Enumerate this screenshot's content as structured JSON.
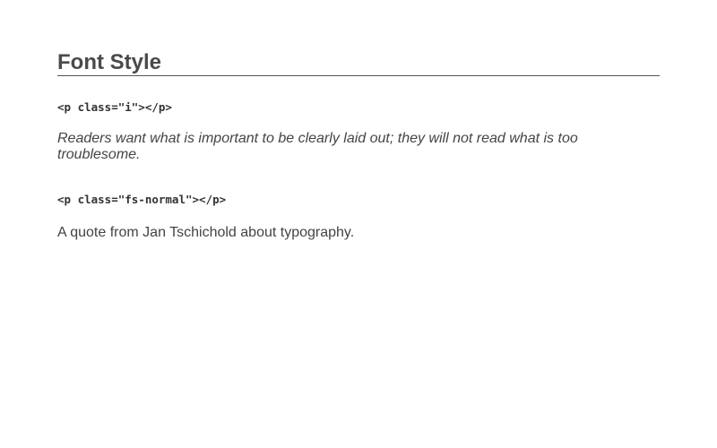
{
  "section": {
    "title": "Font Style"
  },
  "examples": [
    {
      "code": "<p class=\"i\"></p>",
      "text": "Readers want what is important to be clearly laid out; they will not read what is too troublesome."
    },
    {
      "code": "<p class=\"fs-normal\"></p>",
      "text": "A quote from Jan Tschichold about typography."
    }
  ]
}
